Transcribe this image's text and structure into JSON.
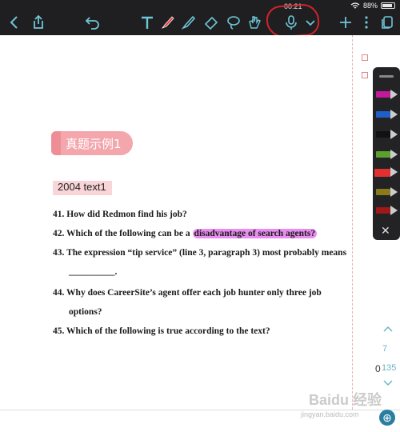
{
  "status": {
    "time": "00:21",
    "battery": "88%"
  },
  "toolbar": {
    "icons": [
      "back-icon",
      "share-icon",
      "undo-icon",
      "text-tool-icon",
      "pen-icon",
      "highlighter-icon",
      "eraser-icon",
      "lasso-icon",
      "hand-icon",
      "microphone-icon",
      "chevron-down-icon",
      "add-icon",
      "more-icon",
      "pages-icon"
    ]
  },
  "document": {
    "heading": "真题示例1",
    "subtitle": "2004 text1",
    "questions": [
      {
        "pre": "41. How did Redmon find his job?",
        "hl": "",
        "post": ""
      },
      {
        "pre": "42. Which of the following can be a ",
        "hl": "disadvantage of search agents?",
        "post": ""
      },
      {
        "pre": "43. The expression “tip service” (line 3, paragraph 3) most probably means",
        "hl": "",
        "post": ""
      },
      {
        "pre": "__________.",
        "hl": "",
        "post": ""
      },
      {
        "pre": "44. Why does CareerSite’s agent offer each job hunter only three job",
        "hl": "",
        "post": ""
      },
      {
        "pre": "options?",
        "hl": "",
        "post": ""
      },
      {
        "pre": "45. Which of the following is true according to the text?",
        "hl": "",
        "post": ""
      }
    ]
  },
  "palette": {
    "pens": [
      {
        "name": "pen-magenta",
        "color": "#c2189a"
      },
      {
        "name": "pen-blue",
        "color": "#1f5fc8"
      },
      {
        "name": "pen-black",
        "color": "#111111"
      },
      {
        "name": "pen-green",
        "color": "#5aa02c"
      },
      {
        "name": "pen-red",
        "color": "#e03030"
      },
      {
        "name": "pen-olive",
        "color": "#8a7a1a"
      },
      {
        "name": "pen-darkred",
        "color": "#a01818"
      }
    ]
  },
  "nav": {
    "current": "7",
    "total": "135",
    "page_zero": "0"
  },
  "watermark": {
    "brand": "Baidu 经验",
    "url": "jingyan.baidu.com"
  }
}
